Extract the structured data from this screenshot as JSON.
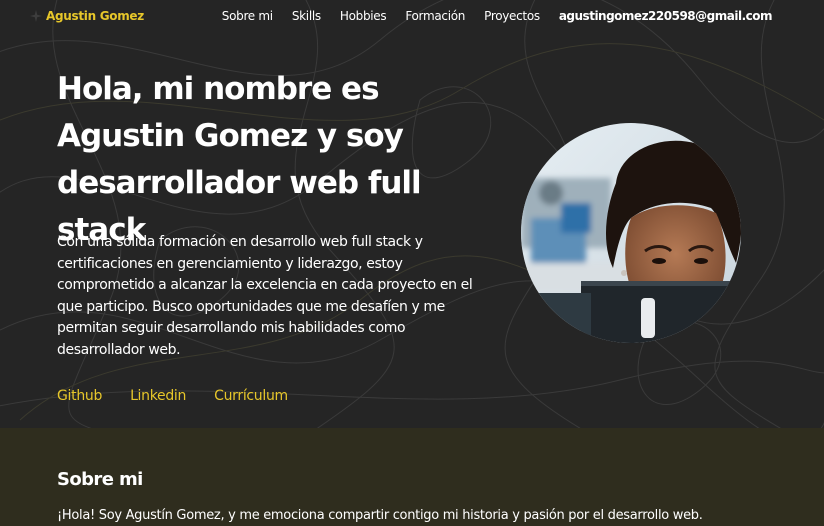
{
  "colors": {
    "accent": "#e7c72a",
    "hero_background": "#252525",
    "about_background": "#2f2d1e",
    "text": "#ffffff"
  },
  "navbar": {
    "brand": "Agustin Gomez",
    "brand_icon": "sparkle-icon",
    "links": [
      "Sobre mi",
      "Skills",
      "Hobbies",
      "Formación",
      "Proyectos"
    ],
    "email": "agustingomez220598@gmail.com"
  },
  "hero": {
    "title": "Hola, mi nombre es Agustin Gomez y soy desarrollador web full stack",
    "description": "Con una sólida formación en desarrollo web full stack y certificaciones en gerenciamiento y liderazgo, estoy comprometido a alcanzar la excelencia en cada proyecto en el que participo. Busco oportunidades que me desafíen y me permitan seguir desarrollando mis habilidades como desarrollador web.",
    "links": [
      "Github",
      "Linkedin",
      "Currículum"
    ]
  },
  "about": {
    "title": "Sobre mi",
    "text": "¡Hola! Soy Agustín Gomez, y me emociona compartir contigo mi historia y pasión por el desarrollo web."
  }
}
